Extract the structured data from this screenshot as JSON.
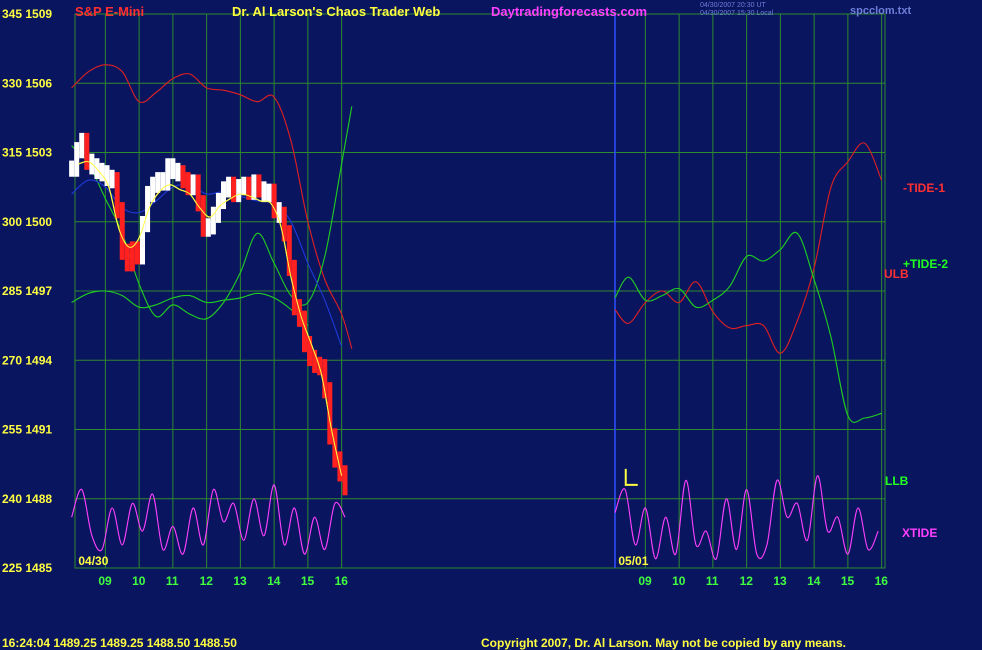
{
  "header": {
    "title_left": "S&P E-Mini",
    "title_center": "Dr. Al Larson's Chaos Trader Web",
    "website": "Daytradingforecasts.com",
    "stamp_line1": "04/30/2007 20:30 UT",
    "stamp_line2": "04/30/2007 15:30 Local",
    "filename": "spcclom.txt"
  },
  "footer": {
    "quote": "16:24:04  1489.25 1489.25 1488.50 1488.50",
    "copyright": "Copyright 2007, Dr. Al Larson. May not be copied by any means."
  },
  "colors": {
    "background": "#0a1560",
    "grid": "#2e8a2e",
    "title_red": "#ff3030",
    "title_yellow": "#ffff40",
    "website": "#ff40ff",
    "footer_yellow": "#ffff40",
    "axis_text": "#ffff40",
    "time_text": "#40ff40"
  },
  "chart_data": {
    "type": "line",
    "title": "S&P E-Mini",
    "y_left_ticks": [
      {
        "osc": 345,
        "price": 1509
      },
      {
        "osc": 330,
        "price": 1506
      },
      {
        "osc": 315,
        "price": 1503
      },
      {
        "osc": 300,
        "price": 1500
      },
      {
        "osc": 285,
        "price": 1497
      },
      {
        "osc": 270,
        "price": 1494
      },
      {
        "osc": 255,
        "price": 1491
      },
      {
        "osc": 240,
        "price": 1488
      },
      {
        "osc": 225,
        "price": 1485
      }
    ],
    "ylim_price": [
      1485,
      1509
    ],
    "ylim_osc": [
      225,
      345
    ],
    "x_ticks": [
      "09",
      "10",
      "11",
      "12",
      "13",
      "14",
      "15",
      "16",
      "09",
      "10",
      "11",
      "12",
      "13",
      "14",
      "15",
      "16"
    ],
    "xlim_hours": [
      8.1,
      32.1
    ],
    "date_labels": [
      {
        "text": "04/30",
        "hour": 8.2
      },
      {
        "text": "05/01",
        "hour": 24.2
      }
    ],
    "session_break_hour": 24.1,
    "grid": true,
    "series": [
      {
        "name": "-TIDE-1",
        "color": "#e02020",
        "x": [
          8,
          8.5,
          9,
          9.5,
          10,
          10.5,
          11,
          11.5,
          12,
          12.5,
          13,
          13.5,
          14,
          14.5,
          15,
          15.5,
          16,
          16.3,
          24.1,
          24.5,
          25,
          25.5,
          26,
          26.5,
          27,
          27.5,
          28,
          28.5,
          29,
          29.5,
          30,
          30.5,
          31,
          31.5,
          32
        ],
        "values": [
          1505.8,
          1506.5,
          1506.8,
          1506.5,
          1505.2,
          1505.6,
          1506.2,
          1506.4,
          1505.8,
          1505.7,
          1505.5,
          1505.2,
          1505.4,
          1503.5,
          1500,
          1497.5,
          1496,
          1494.5,
          1496.2,
          1495.6,
          1496.5,
          1497,
          1496.5,
          1497.4,
          1496.1,
          1495.4,
          1495.5,
          1495.5,
          1494.3,
          1495.7,
          1498,
          1501.5,
          1502.6,
          1503.4,
          1501.8
        ]
      },
      {
        "name": "+TIDE-2",
        "color": "#20d020",
        "x": [
          8,
          8.5,
          9,
          9.5,
          10,
          10.5,
          11,
          11.5,
          12,
          12.5,
          13,
          13.5,
          14,
          14.5,
          15,
          15.5,
          16,
          16.3,
          24.1,
          24.5,
          25,
          25.5,
          26,
          26.5,
          27,
          27.5,
          28,
          28.5,
          29,
          29.5,
          30,
          30.5,
          31,
          31.5,
          32
        ],
        "values": [
          1503.3,
          1502.5,
          1501,
          1499.5,
          1497.3,
          1495.9,
          1496.4,
          1496,
          1495.8,
          1496.5,
          1497.8,
          1499.5,
          1498.2,
          1496.8,
          1496.5,
          1498.5,
          1502.5,
          1505,
          1496.7,
          1497.6,
          1496.6,
          1496.8,
          1497.1,
          1496.3,
          1496.6,
          1497.2,
          1498.5,
          1498.3,
          1498.8,
          1499.5,
          1497.5,
          1495,
          1491.6,
          1491.5,
          1491.7
        ]
      },
      {
        "name": "ULB",
        "color": "#1e3ad8",
        "x": [
          8,
          8.5,
          9,
          9.5,
          10,
          10.5,
          11,
          11.5,
          12,
          12.5,
          13,
          13.5,
          14,
          14.5,
          15,
          15.5,
          16
        ],
        "values": [
          1501.2,
          1501.8,
          1501.5,
          1500.6,
          1500.4,
          1500.9,
          1501.5,
          1501.6,
          1501.2,
          1501.3,
          1501.1,
          1500.9,
          1500.8,
          1500,
          1498.2,
          1496.6,
          1494.6
        ]
      },
      {
        "name": "LLB",
        "color": "#20d020",
        "x": [
          8,
          8.5,
          9,
          9.5,
          10,
          10.5,
          11,
          11.5,
          12,
          12.5,
          13,
          13.5,
          14,
          14.5,
          15
        ],
        "values": [
          1496.5,
          1496.9,
          1497,
          1496.8,
          1496.3,
          1496.4,
          1496.7,
          1496.8,
          1496.5,
          1496.6,
          1496.7,
          1496.9,
          1496.7,
          1496.2,
          1495.5
        ]
      },
      {
        "name": "XTIDE",
        "color": "#ff40ff",
        "x": [
          8,
          8.3,
          8.6,
          8.9,
          9.2,
          9.5,
          9.8,
          10.1,
          10.4,
          10.7,
          11,
          11.3,
          11.6,
          11.9,
          12.2,
          12.5,
          12.8,
          13.1,
          13.4,
          13.7,
          14,
          14.3,
          14.6,
          14.9,
          15.2,
          15.5,
          15.8,
          16.1,
          24.1,
          24.4,
          24.7,
          25,
          25.3,
          25.6,
          25.9,
          26.2,
          26.5,
          26.8,
          27.1,
          27.4,
          27.7,
          28,
          28.3,
          28.6,
          28.9,
          29.2,
          29.5,
          29.8,
          30.1,
          30.4,
          30.7,
          31,
          31.3,
          31.6,
          31.9
        ],
        "values": [
          236,
          242,
          232,
          229,
          238,
          230,
          239,
          233,
          241,
          229,
          234,
          228,
          238,
          230,
          242,
          235,
          239,
          231,
          240,
          232,
          243,
          230,
          238,
          228,
          236,
          229,
          239,
          236,
          237,
          242,
          230,
          238,
          227,
          236,
          228,
          244,
          230,
          233,
          227,
          240,
          229,
          242,
          228,
          230,
          244,
          236,
          239,
          231,
          245,
          233,
          236,
          228,
          238,
          229,
          233
        ]
      },
      {
        "name": "Price",
        "color": "#ffffff",
        "x": [
          8,
          8.15,
          8.3,
          8.45,
          8.6,
          8.75,
          8.9,
          9.05,
          9.2,
          9.35,
          9.5,
          9.65,
          9.8,
          9.95,
          10.1,
          10.25,
          10.4,
          10.55,
          10.7,
          10.85,
          11,
          11.15,
          11.3,
          11.45,
          11.6,
          11.75,
          11.9,
          12.05,
          12.2,
          12.35,
          12.5,
          12.65,
          12.8,
          12.95,
          13.1,
          13.25,
          13.4,
          13.55,
          13.7,
          13.85,
          14,
          14.15,
          14.3,
          14.45,
          14.6,
          14.75,
          14.9,
          15.05,
          15.2,
          15.35,
          15.5,
          15.65,
          15.8,
          15.95,
          16.1
        ],
        "values": [
          1502.3,
          1503.1,
          1503.5,
          1502.6,
          1502.4,
          1502.2,
          1502.1,
          1501.9,
          1501.8,
          1500.5,
          1498.7,
          1498.2,
          1498.8,
          1498.5,
          1499.9,
          1501.2,
          1501.6,
          1501.8,
          1501.7,
          1502.4,
          1502.2,
          1502.1,
          1501.8,
          1501.5,
          1501.7,
          1500.8,
          1499.7,
          1499.8,
          1500.3,
          1500.9,
          1501.4,
          1501.6,
          1501.2,
          1501.5,
          1501.6,
          1501.3,
          1501.7,
          1501.4,
          1501.2,
          1501.3,
          1500.5,
          1500.3,
          1499.5,
          1498,
          1496.3,
          1495.8,
          1494.7,
          1494.1,
          1493.8,
          1493.7,
          1492.7,
          1490.7,
          1489.7,
          1489.1,
          1488.5
        ]
      },
      {
        "name": "Average",
        "color": "#ffff40",
        "x": [
          8.2,
          8.5,
          8.8,
          9.1,
          9.4,
          9.7,
          10,
          10.3,
          10.6,
          10.9,
          11.2,
          11.5,
          11.8,
          12.1,
          12.4,
          12.7,
          13,
          13.3,
          13.6,
          13.9,
          14.2,
          14.5,
          14.8,
          15.1,
          15.4,
          15.7,
          16
        ],
        "values": [
          1502.5,
          1502.6,
          1502.2,
          1501.5,
          1499.7,
          1498.9,
          1499.3,
          1500.6,
          1501.3,
          1501.6,
          1501.4,
          1501.2,
          1500.6,
          1500.2,
          1500.7,
          1501,
          1501.2,
          1501.1,
          1500.9,
          1500.8,
          1499.8,
          1497.6,
          1495.9,
          1494.7,
          1493.4,
          1491,
          1489
        ]
      }
    ],
    "forecast_marker": {
      "hour": 24.3,
      "price": 1488.6,
      "color": "#ffff40"
    },
    "right_labels": [
      {
        "text": "-TIDE-1",
        "color": "#ff3030"
      },
      {
        "text": "+TIDE-2",
        "color": "#20ff20"
      },
      {
        "text": "ULB",
        "color": "#ff3030"
      },
      {
        "text": "LLB",
        "color": "#20ff20"
      },
      {
        "text": "XTIDE",
        "color": "#ff40ff"
      }
    ]
  }
}
